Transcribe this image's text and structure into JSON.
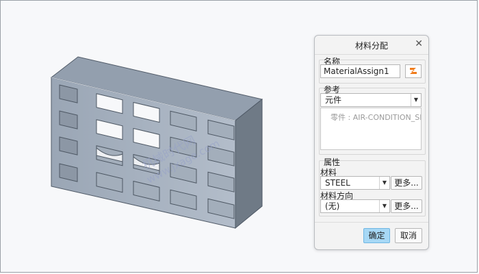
{
  "watermark": {
    "line1": "机械时代网",
    "line2": "www.jxage.com"
  },
  "dialog": {
    "title": "材料分配",
    "close_glyph": "✕",
    "name_label": "名称",
    "name_value": "MaterialAssign1",
    "references_label": "参考",
    "ref_type": "元件",
    "ref_item": "零件 : AIR-CONDITION_SH",
    "properties_label": "属性",
    "material_label": "材料",
    "material_value": "STEEL",
    "more_label": "更多...",
    "direction_label": "材料方向",
    "direction_value": "(无)",
    "ok_label": "确定",
    "cancel_label": "取消"
  },
  "colors": {
    "primary_button": "#a7d8f5",
    "model_front": "#a9b4c2",
    "model_top": "#939fae",
    "model_side": "#6f7a86"
  },
  "icons": {
    "rename": "edit-name-icon",
    "close": "close-icon",
    "dropdown": "chevron-down-icon"
  }
}
